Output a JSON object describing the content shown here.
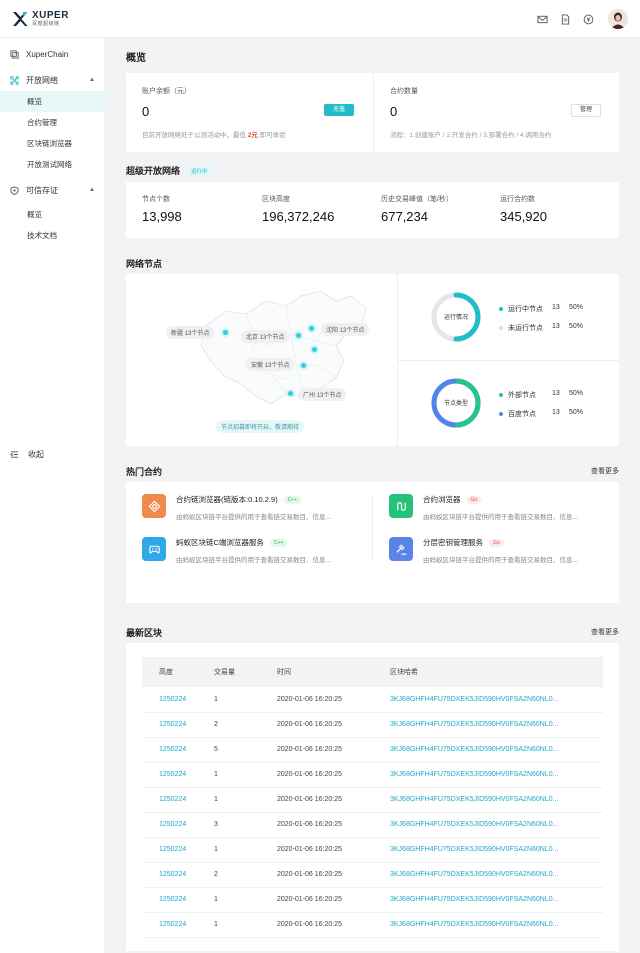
{
  "brand": {
    "name": "XUPER",
    "subtitle": "百度超级链"
  },
  "topbar": {
    "icons": [
      "mail-icon",
      "document-icon",
      "currency-icon"
    ]
  },
  "sidebar": {
    "top_item": "XuperChain",
    "groups": [
      {
        "label": "开放网络",
        "items": [
          "概览",
          "合约管理",
          "区块链浏览器",
          "开放测试网络"
        ]
      },
      {
        "label": "可信存证",
        "items": [
          "概览",
          "技术文档"
        ]
      }
    ],
    "collapse": "收起"
  },
  "overview": {
    "title": "概览",
    "balance": {
      "label": "账户余额（元）",
      "value": "0",
      "button": "充值",
      "hint_pre": "目前开放网络处于公测活动中，最低",
      "hint_amount": "2元",
      "hint_post": "即可体验"
    },
    "contracts": {
      "label": "合约数量",
      "value": "0",
      "button": "管理",
      "hint": "流程：1.创建账户 / 2.开发合约 / 3.部署合约 / 4.调用合约"
    }
  },
  "network": {
    "title": "超级开放网络",
    "status": "运行中",
    "stats": [
      {
        "label": "节点个数",
        "value": "13,998"
      },
      {
        "label": "区块高度",
        "value": "196,372,246"
      },
      {
        "label": "历史交易峰值（笔/秒）",
        "value": "677,234"
      },
      {
        "label": "运行合约数",
        "value": "345,920"
      }
    ]
  },
  "nodes": {
    "title": "网络节点",
    "map_tags": [
      {
        "name": "新疆",
        "text": "13个节点"
      },
      {
        "name": "北京",
        "text": "13个节点"
      },
      {
        "name": "沈阳",
        "text": "13个节点"
      },
      {
        "name": "安徽",
        "text": "13个节点"
      },
      {
        "name": "广州",
        "text": "13个节点"
      }
    ],
    "map_note": "节点招募即将开启，敬请期待",
    "run_chart": {
      "center": "运行情况",
      "items": [
        {
          "label": "运行中节点",
          "count": "13",
          "pct": "50%",
          "fraction": 0.5,
          "color": "#21bcc7"
        },
        {
          "label": "未运行节点",
          "count": "13",
          "pct": "50%",
          "fraction": 0.5,
          "color": "#e4e6e9"
        }
      ]
    },
    "type_chart": {
      "center": "节点类型",
      "items": [
        {
          "label": "外部节点",
          "count": "13",
          "pct": "50%",
          "fraction": 0.5,
          "color": "#25c58a"
        },
        {
          "label": "百度节点",
          "count": "13",
          "pct": "50%",
          "fraction": 0.5,
          "color": "#4f86e8"
        }
      ]
    }
  },
  "hot": {
    "title": "热门合约",
    "more": "查看更多",
    "items": [
      {
        "title": "合约链浏览器(链版本:0.10.2.9)",
        "tag": "C++",
        "desc": "由蚂蚁区块链平台提供的用于查看链交易数目、信息...",
        "icon": "target-icon",
        "color": "#f08a4b"
      },
      {
        "title": "合约浏览器",
        "tag": "Go",
        "desc": "由蚂蚁区块链平台提供的用于查看链交易数目、信息...",
        "icon": "flow-icon",
        "color": "#27c27a"
      },
      {
        "title": "蚂蚁区块链C端浏览器服务",
        "tag": "C++",
        "desc": "由蚂蚁区块链平台提供的用于查看链交易数目、信息...",
        "icon": "gamepad-icon",
        "color": "#2fa8e8"
      },
      {
        "title": "分层密钥管理服务",
        "tag": "Go",
        "desc": "由蚂蚁区块链平台提供的用于查看链交易数目、信息...",
        "icon": "gavel-icon",
        "color": "#5a84e8"
      }
    ]
  },
  "blocks": {
    "title": "最新区块",
    "more": "查看更多",
    "columns": [
      "高度",
      "交易量",
      "时间",
      "区块哈希"
    ],
    "rows": [
      [
        "1250224",
        "1",
        "2020-01-06 16:20:25",
        "3KJ68GHFH4FU75DXEK5JID590HV0FSA2N60NL0..."
      ],
      [
        "1250224",
        "2",
        "2020-01-06 16:20:25",
        "3KJ68GHFH4FU75DXEK5JID590HV0FSA2N60NL0..."
      ],
      [
        "1250224",
        "5",
        "2020-01-06 16:20:25",
        "3KJ68GHFH4FU75DXEK5JID590HV0FSA2N60NL0..."
      ],
      [
        "1250224",
        "1",
        "2020-01-06 16:20:25",
        "3KJ68GHFH4FU75DXEK5JID590HV0FSA2N60NL0..."
      ],
      [
        "1250224",
        "1",
        "2020-01-06 16:20:25",
        "3KJ68GHFH4FU75DXEK5JID590HV0FSA2N60NL0..."
      ],
      [
        "1250224",
        "3",
        "2020-01-06 16:20:25",
        "3KJ68GHFH4FU75DXEK5JID590HV0FSA2N60NL0..."
      ],
      [
        "1250224",
        "1",
        "2020-01-06 16:20:25",
        "3KJ68GHFH4FU75DXEK5JID590HV0FSA2N60NL0..."
      ],
      [
        "1250224",
        "2",
        "2020-01-06 16:20:25",
        "3KJ68GHFH4FU75DXEK5JID590HV0FSA2N60NL0..."
      ],
      [
        "1250224",
        "1",
        "2020-01-06 16:20:25",
        "3KJ68GHFH4FU75DXEK5JID590HV0FSA2N60NL0..."
      ],
      [
        "1250224",
        "1",
        "2020-01-06 16:20:25",
        "3KJ68GHFH4FU75DXEK5JID590HV0FSA2N60NL0..."
      ]
    ]
  }
}
